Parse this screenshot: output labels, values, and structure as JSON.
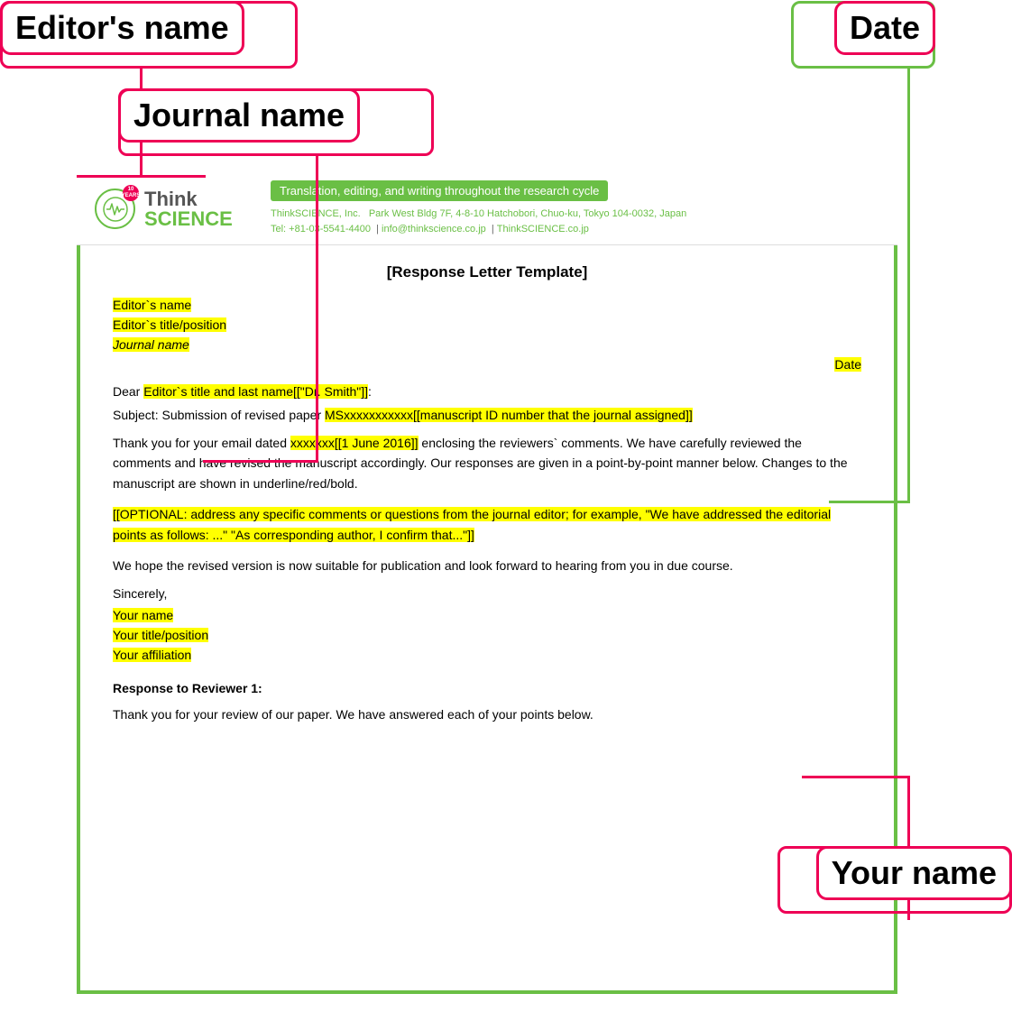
{
  "annotations": {
    "editors_name_label": "Editor's name",
    "journal_name_label": "Journal name",
    "date_label": "Date",
    "your_name_label": "Your name"
  },
  "letter": {
    "title": "[Response Letter Template]",
    "editor_name_field": "Editor`s name",
    "editor_title_field": "Editor`s title/position",
    "journal_name_field": "Journal name",
    "date_field": "Date",
    "dear_line_start": "Dear ",
    "dear_highlight": "Editor`s title and last name[[\"Dr. Smith\"]]",
    "dear_line_end": ":",
    "subject_start": "Subject:  Submission of revised paper  ",
    "subject_highlight": "MSxxxxxxxxxxx[[manuscript ID number that the journal assigned]]",
    "body1": "Thank you for your email dated ",
    "body1_highlight": "xxxxxxx[[1 June 2016]]",
    "body1_end": " enclosing the reviewers` comments. We have carefully reviewed the comments and have revised the manuscript accordingly. Our responses are given in a point-by-point manner below. Changes to the manuscript are shown in underline/red/bold.",
    "optional_highlight": "[[OPTIONAL: address any specific comments or questions from the journal editor; for example, \"We have addressed the editorial points as follows: ...\" \"As corresponding author, I confirm that...\"]]",
    "body2": "We hope the revised version is now suitable for publication and look forward to hearing from you in due course.",
    "sincerely": "Sincerely,",
    "your_name_field": "Your name",
    "your_title_field": "Your title/position",
    "your_affiliation_field": "Your affiliation",
    "reviewer_header": "Response to Reviewer 1:",
    "reviewer_body": "Thank you for your review of our paper. We have answered each of your points below."
  },
  "thinkscience": {
    "badge": "10 YEARS",
    "think": "Think",
    "science": "SCIENCE",
    "tagline": "Translation, editing, and writing throughout the research cycle",
    "company": "ThinkSCIENCE, Inc.",
    "address": "Park West Bldg 7F, 4-8-10 Hatchobori, Chuo-ku, Tokyo 104-0032, Japan",
    "tel": "Tel: +81-03-5541-4400",
    "email": "info@thinkscience.co.jp",
    "website": "ThinkSCIENCE.co.jp"
  }
}
